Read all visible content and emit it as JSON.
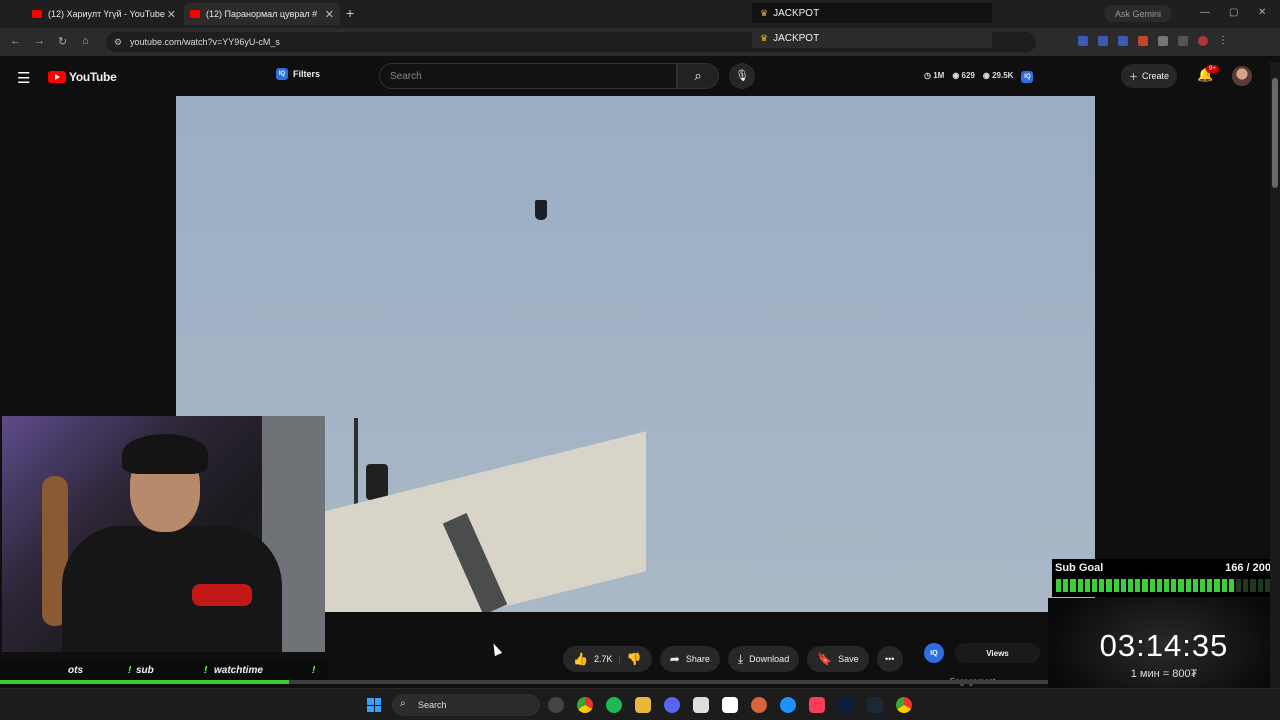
{
  "browser": {
    "tabs": [
      {
        "title": "(12) Хариулт Үгүй - YouTube"
      },
      {
        "title": "(12) Паранормал цуврал #"
      }
    ],
    "jackpot": [
      "JACKPOT",
      "JACKPOT"
    ],
    "gemini": "Ask Gemini",
    "url": "youtube.com/watch?v=YY96yU-cM_s"
  },
  "youtube": {
    "logo": "YouTube",
    "filters": "Filters",
    "search_placeholder": "Search",
    "stats": [
      "1M",
      "629",
      "29.5K"
    ],
    "create": "Create",
    "notif_count": "9+"
  },
  "actions": {
    "likes": "2.7K",
    "share": "Share",
    "download": "Download",
    "save": "Save",
    "views": "Views",
    "engagement": "Engagement",
    "iq": "IQ"
  },
  "overlay": {
    "commands": [
      "ots",
      "!",
      "sub",
      "!",
      "watchtime",
      "!"
    ],
    "sub_goal_title": "Sub Goal",
    "sub_goal_count": "166 / 200",
    "sub_goal_progress": 0.83,
    "timer": "03:14:35",
    "rate": "1 мин = 800₮"
  },
  "video": {
    "progress": 0.226
  },
  "taskbar": {
    "search": "Search"
  },
  "colors": {
    "accent": "#ff0000",
    "goal_green": "#37d23a",
    "timer_yellow": "#f7d51f"
  }
}
